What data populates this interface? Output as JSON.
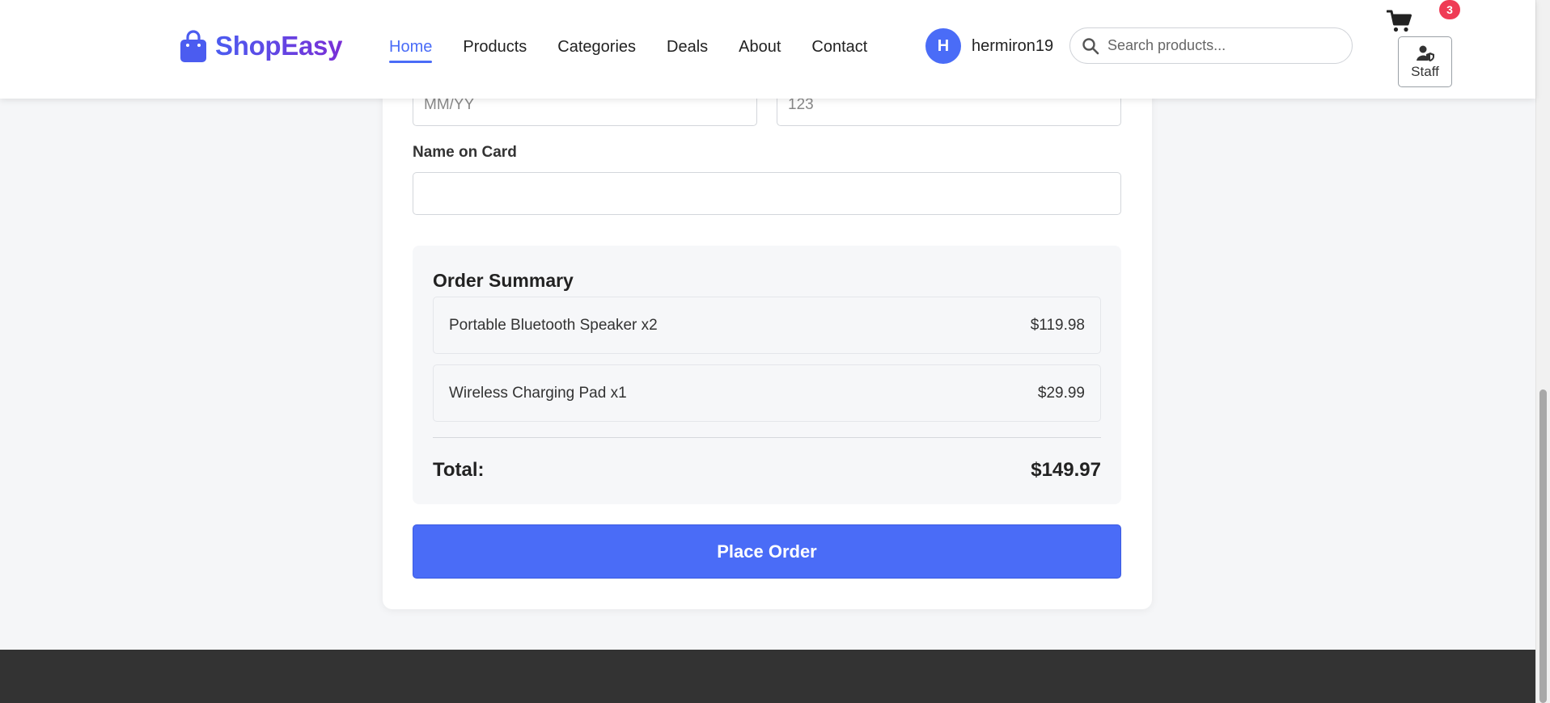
{
  "brand": {
    "name": "ShopEasy",
    "icon": "shopping-bag-icon"
  },
  "nav": [
    {
      "label": "Home",
      "active": true
    },
    {
      "label": "Products",
      "active": false
    },
    {
      "label": "Categories",
      "active": false
    },
    {
      "label": "Deals",
      "active": false
    },
    {
      "label": "About",
      "active": false
    },
    {
      "label": "Contact",
      "active": false
    }
  ],
  "user": {
    "initial": "H",
    "username": "hermiron19"
  },
  "search": {
    "placeholder": "Search products...",
    "value": ""
  },
  "cart": {
    "count": "3",
    "icon": "shopping-cart-icon"
  },
  "staff": {
    "label": "Staff",
    "icon": "user-shield-icon"
  },
  "payment": {
    "expiry_placeholder": "MM/YY",
    "cvv_placeholder": "123",
    "name_label": "Name on Card",
    "name_value": ""
  },
  "summary": {
    "title": "Order Summary",
    "items": [
      {
        "name": "Portable Bluetooth Speaker x2",
        "price": "$119.98"
      },
      {
        "name": "Wireless Charging Pad x1",
        "price": "$29.99"
      }
    ],
    "total_label": "Total:",
    "total_value": "$149.97"
  },
  "actions": {
    "place_order": "Place Order"
  },
  "colors": {
    "accent": "#4a6cf7",
    "brand_gradient_end": "#7a2fd6",
    "badge": "#ef3b55",
    "footer": "#333333"
  }
}
